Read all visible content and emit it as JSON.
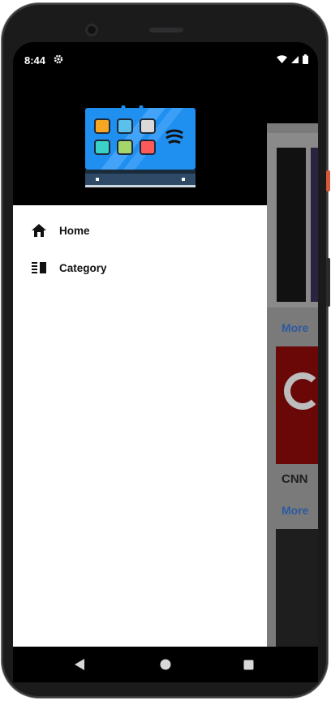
{
  "status_bar": {
    "time": "8:44",
    "icons": [
      "gear-icon",
      "wifi-icon",
      "cell-signal-icon",
      "battery-icon"
    ]
  },
  "drawer": {
    "menu": [
      {
        "label": "Home",
        "icon": "home-icon"
      },
      {
        "label": "Category",
        "icon": "category-icon"
      }
    ]
  },
  "background_app": {
    "more_label_1": "More",
    "channel_name": "CNN",
    "more_label_2": "More"
  },
  "navbar": {
    "icons": [
      "back-icon",
      "home-circle-icon",
      "recents-icon"
    ]
  },
  "colors": {
    "drawer_bg": "#ffffff",
    "header_bg": "#000000",
    "accent_link": "#2c5aa0"
  }
}
